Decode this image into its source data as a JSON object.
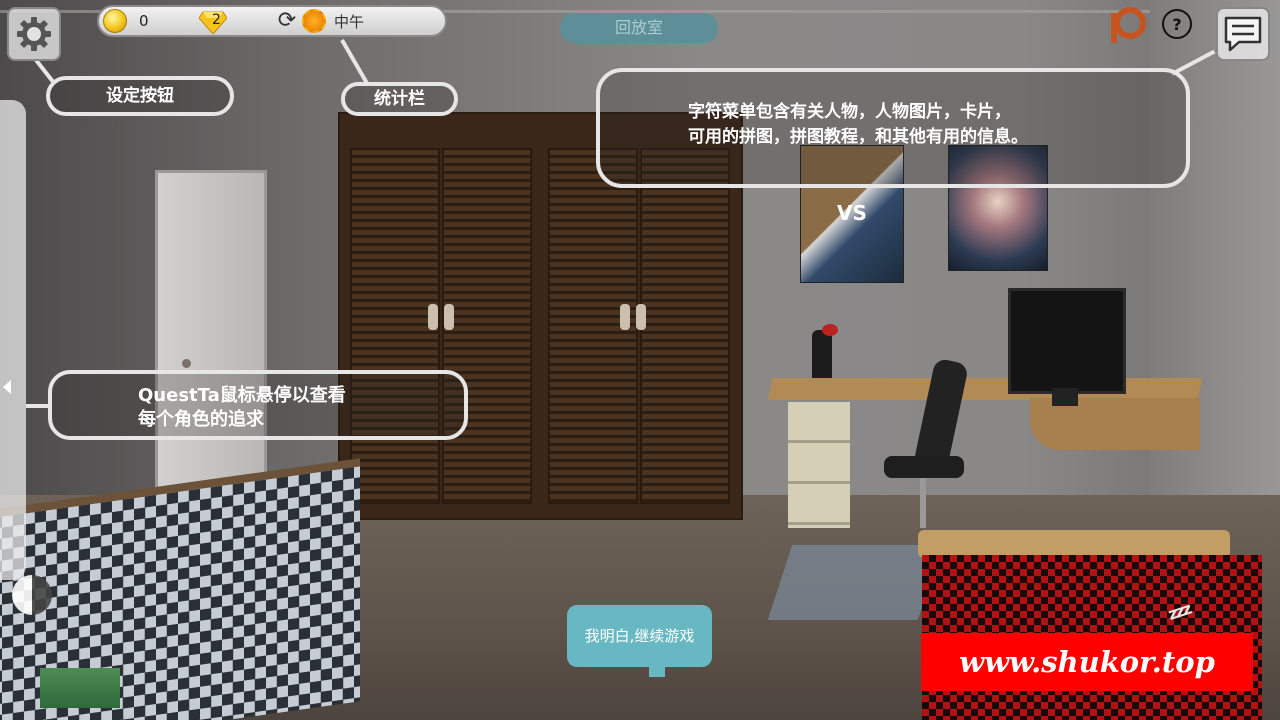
{
  "hud": {
    "coins": "0",
    "gems": "2",
    "time_of_day": "中午",
    "replay_room_tab": "回放室",
    "help_symbol": "?"
  },
  "tutorial": {
    "settings_callout": "设定按钮",
    "stats_callout": "统计栏",
    "character_menu_line1": "字符菜单包含有关人物，人物图片，卡片，",
    "character_menu_line2": "可用的拼图，拼图教程，和其他有用的信息。",
    "quest_line1": "QuestTa鼠标悬停以查看",
    "quest_line2": "每个角色的追求",
    "continue_button": "我明白,继续游戏"
  },
  "scene": {
    "poster_text": "VS",
    "sleep_text": "zzz"
  },
  "watermark": "www.shukor.top",
  "colors": {
    "accent_teal": "#67b8c2",
    "callout_border": "#e6e6e6",
    "watermark_bg": "#ff0000"
  },
  "icons": [
    "gear-icon",
    "coin-icon",
    "gem-icon",
    "refresh-icon",
    "sun-icon",
    "patreon-icon",
    "help-icon",
    "chat-icon"
  ]
}
